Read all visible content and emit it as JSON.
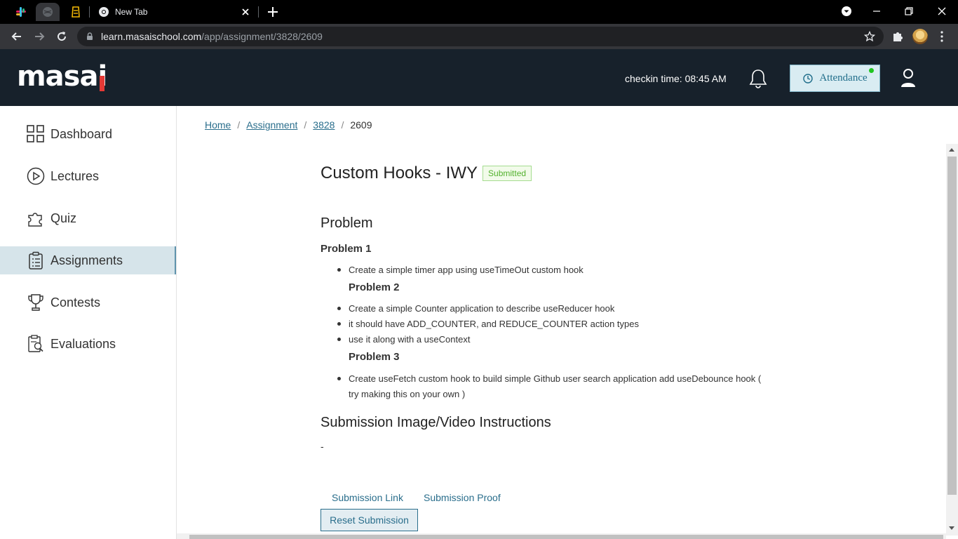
{
  "browser": {
    "tabs": [
      {
        "label": "",
        "icon": "slack-icon"
      },
      {
        "label": "",
        "icon": "globe-icon"
      },
      {
        "label": "",
        "icon": "bookmark-app-icon"
      },
      {
        "label": "New Tab",
        "icon": "chrome-icon"
      }
    ],
    "url_domain": "learn.masaischool.com",
    "url_path": "/app/assignment/3828/2609"
  },
  "header": {
    "logo": "masai",
    "checkin_text": "checkin time: 08:45 AM",
    "attendance_label": "Attendance",
    "status_dot_color": "#1fc51f"
  },
  "sidebar": {
    "items": [
      {
        "label": "Dashboard",
        "icon": "grid-icon"
      },
      {
        "label": "Lectures",
        "icon": "play-circle-icon"
      },
      {
        "label": "Quiz",
        "icon": "puzzle-icon"
      },
      {
        "label": "Assignments",
        "icon": "clipboard-icon",
        "active": true
      },
      {
        "label": "Contests",
        "icon": "trophy-icon"
      },
      {
        "label": "Evaluations",
        "icon": "evaluation-icon"
      }
    ]
  },
  "breadcrumb": {
    "home": "Home",
    "assignment": "Assignment",
    "id": "3828",
    "current": "2609"
  },
  "assignment": {
    "title": "Custom Hooks - IWY",
    "status": "Submitted",
    "problem_heading": "Problem",
    "problems": [
      {
        "title": "Problem 1",
        "bullets": [
          "Create a simple timer app using useTimeOut custom hook"
        ]
      },
      {
        "title": "Problem 2",
        "bullets": [
          "Create a simple Counter application to describe useReducer hook",
          "it should have ADD_COUNTER, and REDUCE_COUNTER action types",
          "use it along with a useContext"
        ]
      },
      {
        "title": "Problem 3",
        "bullets": [
          "Create useFetch custom hook to build simple Github user search application add useDebounce hook (",
          "try making this on your own )"
        ]
      }
    ],
    "submission_heading": "Submission Image/Video Instructions",
    "submission_text": "-",
    "tabs": [
      "Submission Link",
      "Submission Proof"
    ],
    "reset_label": "Reset Submission"
  }
}
